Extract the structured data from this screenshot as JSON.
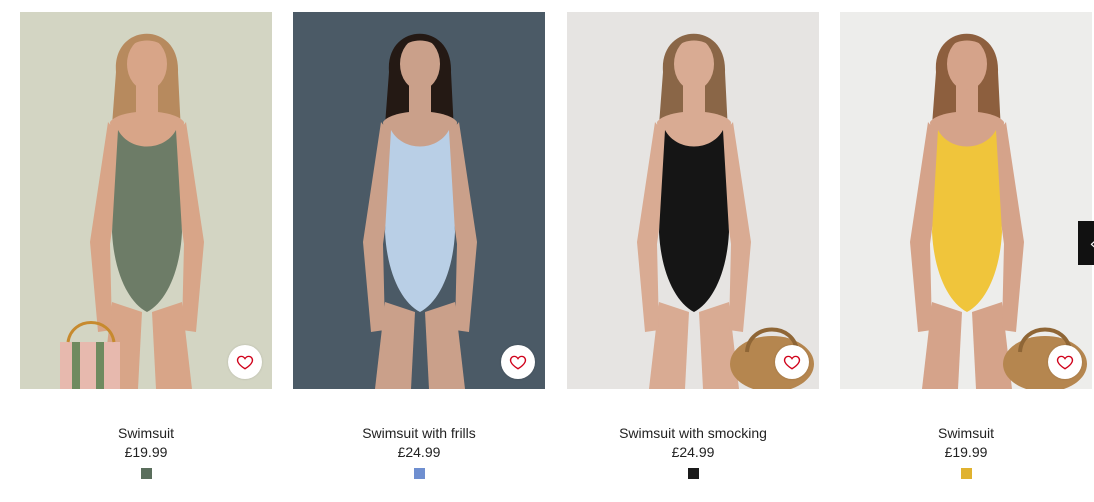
{
  "products": [
    {
      "name": "Swimsuit",
      "price": "£19.99",
      "swatch_color": "#5a6e5c",
      "background": "#d3d5c3",
      "suit_color": "#6d7c67",
      "skin_color": "#d8a588",
      "hair_color": "#b78a5e",
      "accessory": "bag-striped-pink"
    },
    {
      "name": "Swimsuit with frills",
      "price": "£24.99",
      "swatch_color": "#6f8fd0",
      "background": "#4b5a66",
      "suit_color": "#b9cfe6",
      "skin_color": "#caa08a",
      "hair_color": "#241914",
      "accessory": "none"
    },
    {
      "name": "Swimsuit with smocking",
      "price": "£24.99",
      "swatch_color": "#1a1a1a",
      "background": "#e6e4e2",
      "suit_color": "#151515",
      "skin_color": "#d9ab93",
      "hair_color": "#8a6647",
      "accessory": "bag-wicker"
    },
    {
      "name": "Swimsuit",
      "price": "£19.99",
      "swatch_color": "#e0b22f",
      "background": "#ededeb",
      "suit_color": "#f0c53b",
      "skin_color": "#d5a38a",
      "hair_color": "#8d5f3e",
      "accessory": "bag-wicker"
    }
  ],
  "icons": {
    "favourite": "heart-outline-icon",
    "next": "chevron-right-icon"
  },
  "accent": "#d0021b"
}
